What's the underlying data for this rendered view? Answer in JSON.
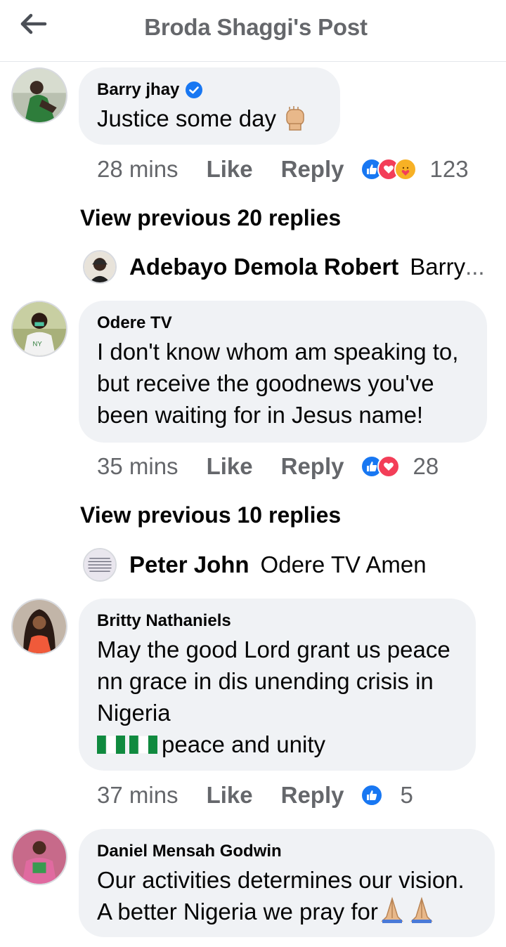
{
  "header": {
    "title": "Broda Shaggi's Post",
    "back_icon": "arrow-left-icon"
  },
  "colors": {
    "bubble": "#f0f2f5",
    "meta": "#65676b",
    "like_blue": "#1877f2",
    "love_red": "#f33e58",
    "care_yellow": "#f7b125"
  },
  "comments": [
    {
      "author": "Barry jhay",
      "verified": true,
      "text": "Justice some day",
      "emoji": "raised-fist",
      "time": "28 mins",
      "like": "Like",
      "reply": "Reply",
      "reactions": [
        "like",
        "love",
        "care"
      ],
      "reaction_count": "123"
    },
    {
      "author": "Odere TV",
      "verified": false,
      "lines": [
        "I don't know whom am speaking to,",
        "but receive the goodnews you've",
        "been waiting for in Jesus name!"
      ],
      "time": "35 mins",
      "like": "Like",
      "reply": "Reply",
      "reactions": [
        "like",
        "love"
      ],
      "reaction_count": "28"
    },
    {
      "author": "Britty Nathaniels",
      "verified": false,
      "lines": [
        "May the good Lord grant us peace",
        "nn grace in dis unending crisis in",
        "Nigeria"
      ],
      "last_line": "peace and unity",
      "time": "37 mins",
      "like": "Like",
      "reply": "Reply",
      "reactions": [
        "like"
      ],
      "reaction_count": "5"
    },
    {
      "author": "Daniel Mensah Godwin",
      "verified": false,
      "lines": [
        "Our activities determines our vision.",
        "A better Nigeria we pray for"
      ],
      "emoji": "folded-hands"
    }
  ],
  "view_previous": [
    {
      "label": "View previous 20 replies"
    },
    {
      "label": "View previous 10 replies"
    }
  ],
  "replies": [
    {
      "name": "Adebayo Demola Robert",
      "text": "Barry",
      "ellipsis": "..."
    },
    {
      "name": "Peter John",
      "text": "Odere TV Amen"
    }
  ]
}
